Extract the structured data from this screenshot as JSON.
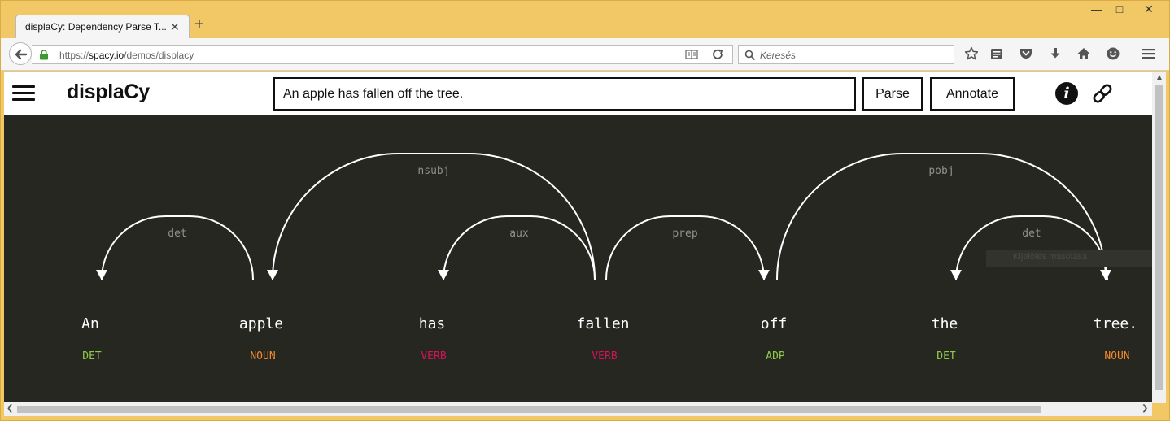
{
  "browser": {
    "tab_title": "displaCy: Dependency Parse T...",
    "url_prefix": "https://",
    "url_domain": "spacy.io",
    "url_path": "/demos/displacy",
    "search_placeholder": "Keresés"
  },
  "header": {
    "brand": "displaCy",
    "sentence": "An apple has fallen off the tree.",
    "parse_label": "Parse",
    "annotate_label": "Annotate",
    "info_glyph": "i"
  },
  "parse": {
    "words": [
      {
        "text": "An",
        "tag": "DET",
        "color": "#8ccb46"
      },
      {
        "text": "apple",
        "tag": "NOUN",
        "color": "#f08a2a"
      },
      {
        "text": "has",
        "tag": "VERB",
        "color": "#d4145a"
      },
      {
        "text": "fallen",
        "tag": "VERB",
        "color": "#d4145a"
      },
      {
        "text": "off",
        "tag": "ADP",
        "color": "#8ccb46"
      },
      {
        "text": "the",
        "tag": "DET",
        "color": "#8ccb46"
      },
      {
        "text": "tree.",
        "tag": "NOUN",
        "color": "#f08a2a"
      }
    ],
    "arcs": [
      {
        "label": "det",
        "from": 1,
        "to": 0,
        "level": 1
      },
      {
        "label": "nsubj",
        "from": 3,
        "to": 1,
        "level": 2
      },
      {
        "label": "aux",
        "from": 3,
        "to": 2,
        "level": 1
      },
      {
        "label": "prep",
        "from": 3,
        "to": 4,
        "level": 1
      },
      {
        "label": "pobj",
        "from": 4,
        "to": 6,
        "level": 2
      },
      {
        "label": "det",
        "from": 6,
        "to": 5,
        "level": 1
      }
    ],
    "tooltip": "Kijelölés másolása"
  },
  "colors": {
    "canvas": "#272722",
    "arc": "#ffffff",
    "arc_label": "#8f8f8f"
  }
}
